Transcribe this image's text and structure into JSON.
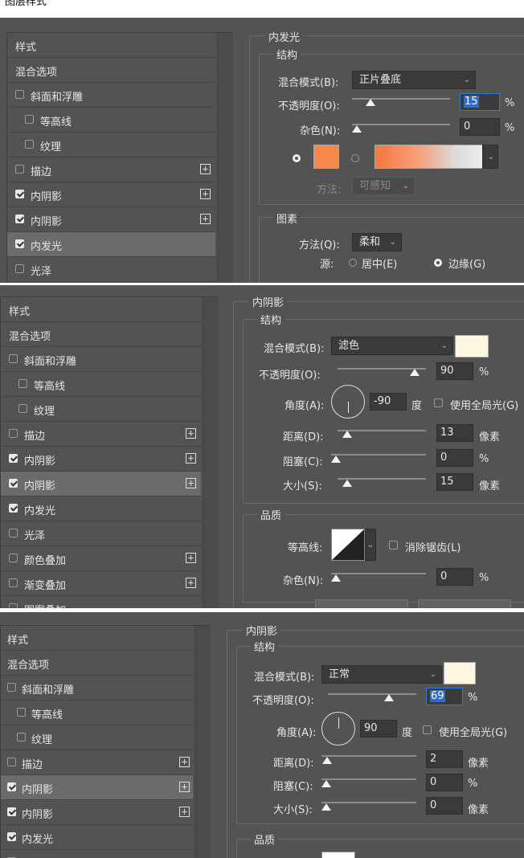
{
  "window": {
    "title": "图层样式"
  },
  "sidebar": {
    "header": "样式",
    "items": [
      {
        "label": "混合选项"
      },
      {
        "label": "斜面和浮雕"
      },
      {
        "label": "等高线"
      },
      {
        "label": "纹理"
      },
      {
        "label": "描边"
      },
      {
        "label": "内阴影"
      },
      {
        "label": "内阴影"
      },
      {
        "label": "内发光"
      },
      {
        "label": "光泽"
      },
      {
        "label": "颜色叠加"
      },
      {
        "label": "渐变叠加"
      },
      {
        "label": "图案叠加"
      }
    ],
    "plus_glyph": "+"
  },
  "panel1": {
    "section": "内发光",
    "structure_title": "结构",
    "blend_label": "混合模式(B):",
    "blend_value": "正片叠底",
    "opacity_label": "不透明度(O):",
    "opacity_value": "15",
    "noise_label": "杂色(N):",
    "noise_value": "0",
    "pct": "%",
    "color_hex": "#f5884a",
    "method_label": "方法:",
    "method_value": "可感知",
    "elements_title": "图素",
    "technique_label": "方法(Q):",
    "technique_value": "柔和",
    "source_label": "源:",
    "source_center": "居中(E)",
    "source_edge": "边缘(G)",
    "chevron": "⌄"
  },
  "panel2": {
    "section": "内阴影",
    "structure_title": "结构",
    "blend_label": "混合模式(B):",
    "blend_value": "滤色",
    "color_hex": "#fdf6e0",
    "opacity_label": "不透明度(O):",
    "opacity_value": "90",
    "angle_label": "角度(A):",
    "angle_value": "-90",
    "degree": "度",
    "global_light": "使用全局光(G)",
    "distance_label": "距离(D):",
    "distance_value": "13",
    "choke_label": "阻塞(C):",
    "choke_value": "0",
    "size_label": "大小(S):",
    "size_value": "15",
    "px": "像素",
    "pct": "%",
    "quality_title": "品质",
    "contour_label": "等高线:",
    "antialias": "消除锯齿(L)",
    "noise_label": "杂色(N):",
    "noise_value": "0",
    "chevron": "⌄"
  },
  "panel3": {
    "section": "内阴影",
    "structure_title": "结构",
    "blend_label": "混合模式(B):",
    "blend_value": "正常",
    "color_hex": "#fdf6e0",
    "opacity_label": "不透明度(O):",
    "opacity_value": "69",
    "angle_label": "角度(A):",
    "angle_value": "90",
    "degree": "度",
    "global_light": "使用全局光(G)",
    "distance_label": "距离(D):",
    "distance_value": "2",
    "choke_label": "阻塞(C):",
    "choke_value": "0",
    "size_label": "大小(S):",
    "size_value": "0",
    "px": "像素",
    "pct": "%",
    "quality_title": "品质",
    "chevron": "⌄"
  },
  "colors": {
    "panel_bg": "#535353",
    "row_selected": "#6b6b6b",
    "accent_focus": "#2f7cd6"
  }
}
